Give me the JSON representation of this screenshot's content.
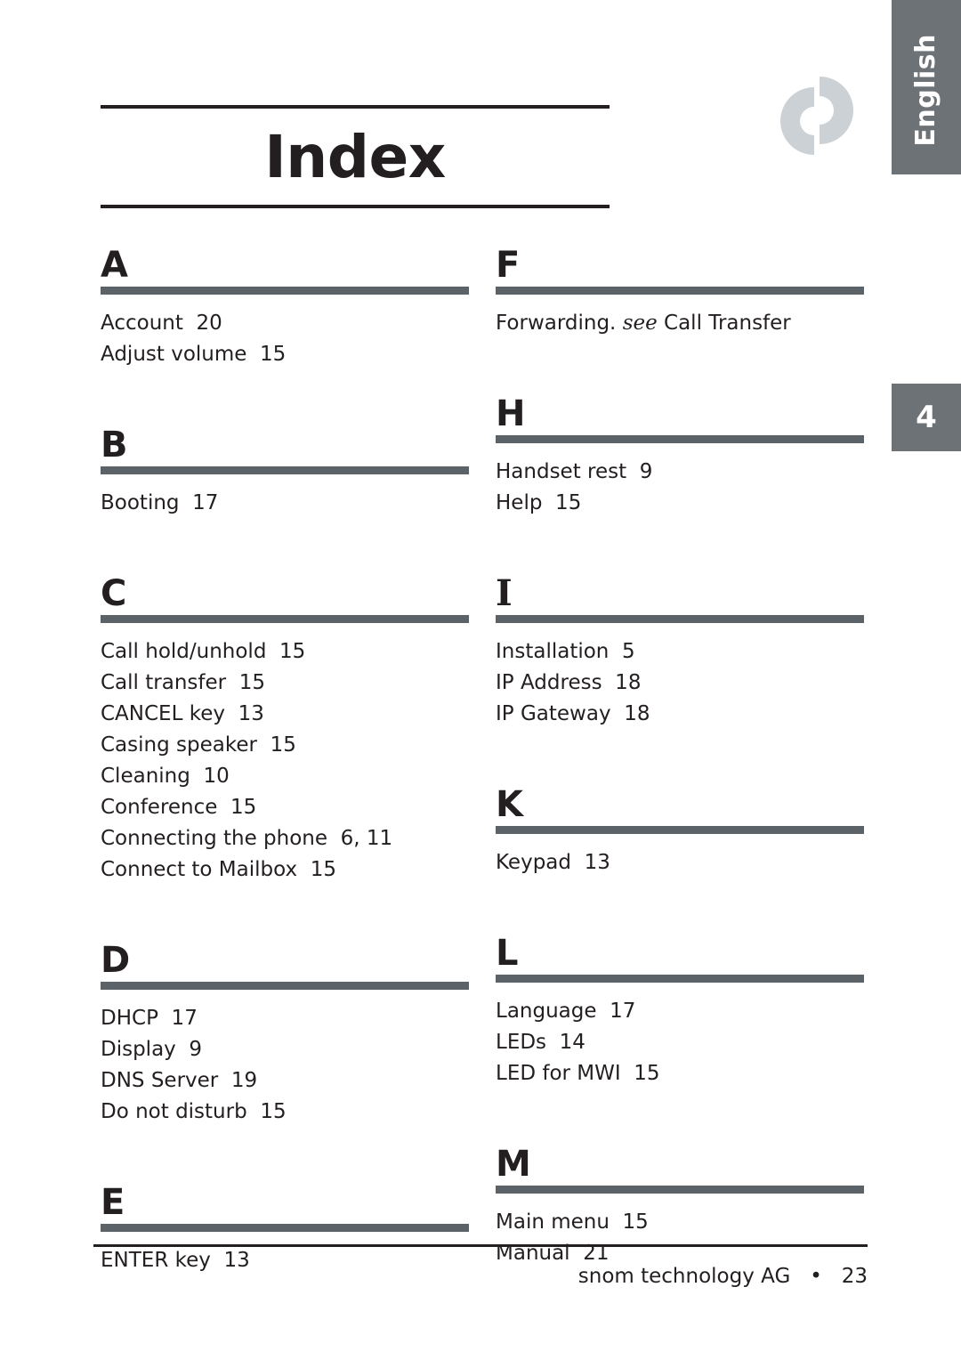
{
  "page": {
    "title": "Index",
    "language_tab": "English",
    "chapter_tab": "4",
    "logo_name": "snom-logo"
  },
  "colors": {
    "tab_gray": "#6d7277",
    "rule_gray": "#5b6268",
    "text_black": "#231f20",
    "logo_gray": "#ccd1d6"
  },
  "index": {
    "left_column": [
      {
        "letter": "A",
        "entries": [
          "Account  20",
          "Adjust volume  15"
        ]
      },
      {
        "letter": "B",
        "entries": [
          "Booting  17"
        ]
      },
      {
        "letter": "C",
        "entries": [
          "Call hold/unhold  15",
          "Call transfer  15",
          "CANCEL key  13",
          "Casing speaker  15",
          "Cleaning  10",
          "Conference  15",
          "Connecting the phone  6, 11",
          "Connect to Mailbox  15"
        ]
      },
      {
        "letter": "D",
        "entries": [
          "DHCP  17",
          "Display  9",
          "DNS Server  19",
          "Do not disturb  15"
        ]
      },
      {
        "letter": "E",
        "entries": [
          "ENTER key  13"
        ]
      }
    ],
    "right_column": [
      {
        "letter": "F",
        "entries_rich": [
          {
            "before": "Forwarding. ",
            "italic": "see",
            "after": " Call Transfer"
          }
        ]
      },
      {
        "letter": "H",
        "entries": [
          "Handset rest  9",
          "Help  15"
        ]
      },
      {
        "letter": "I",
        "entries": [
          "Installation  5",
          "IP Address  18",
          "IP Gateway  18"
        ]
      },
      {
        "letter": "K",
        "entries": [
          "Keypad  13"
        ]
      },
      {
        "letter": "L",
        "entries": [
          "Language  17",
          "LEDs  14",
          "LED for MWI  15"
        ]
      },
      {
        "letter": "M",
        "entries": [
          "Main menu  15",
          "Manual  21"
        ]
      }
    ]
  },
  "footer": {
    "text": "snom technology AG   •   23"
  }
}
